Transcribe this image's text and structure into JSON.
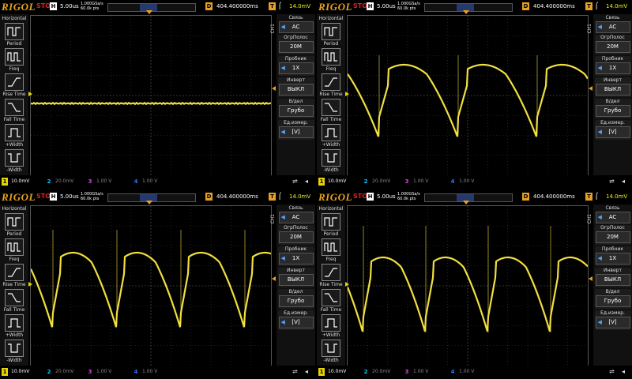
{
  "brand": "RIGOL",
  "status": "STOP",
  "h_label": "H",
  "timebase": "5.00us",
  "sample_rate_line1": "1.000GSa/s",
  "sample_rate_line2": "60.0k pts",
  "delay_label": "D",
  "delay": "404.400000ms",
  "trigger_label": "T",
  "trigger_level": "14.0mV",
  "left_menu": {
    "title": "Horizontal",
    "items": [
      "Period",
      "Freq",
      "Rise Time",
      "Fall Time",
      "+Width",
      "-Width"
    ]
  },
  "right_menu": {
    "coupling_title": "Связь",
    "coupling_value": "AC",
    "bw_title": "ОгрПолос",
    "bw_value": "20M",
    "probe_title": "Пробник",
    "probe_value": "1X",
    "invert_title": "Инверт",
    "invert_value": "ВЫКЛ",
    "vdiv_title": "В/дел",
    "vdiv_value": "Грубо",
    "unit_title": "Ед.измер.",
    "unit_value": "[V]",
    "side_label": "CH1"
  },
  "channels": [
    {
      "num": "1",
      "value": "10.0mV",
      "color": "#e8d400"
    },
    {
      "num": "2",
      "value": "20.0mV",
      "color": "#00c8ff"
    },
    {
      "num": "3",
      "value": "1.00 V",
      "color": "#e040e0"
    },
    {
      "num": "4",
      "value": "1.00 V",
      "color": "#3070ff"
    }
  ],
  "colors": {
    "trace": "#f0e040",
    "grid": "#3a3a3a",
    "accent": "#e8a020"
  },
  "screens": [
    {
      "waveform": "flat"
    },
    {
      "waveform": "sawtooth_arc_a"
    },
    {
      "waveform": "sawtooth_arc_b"
    },
    {
      "waveform": "sawtooth_arc_c"
    }
  ]
}
